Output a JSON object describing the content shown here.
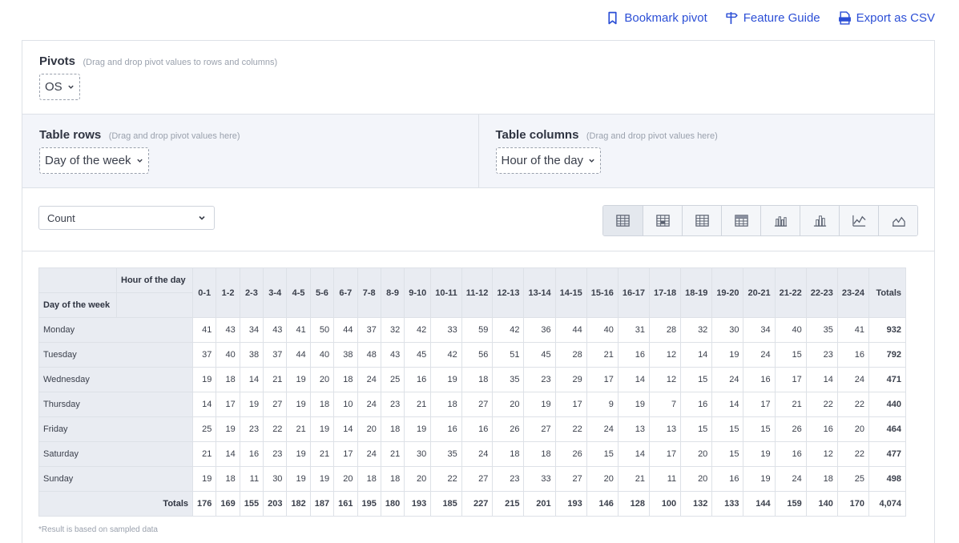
{
  "links": {
    "bookmark": "Bookmark pivot",
    "guide": "Feature Guide",
    "export": "Export as CSV"
  },
  "pivots": {
    "title": "Pivots",
    "hint": "(Drag and drop pivot values to rows and columns)",
    "chip": "OS"
  },
  "rows": {
    "title": "Table rows",
    "hint": "(Drag and drop pivot values here)",
    "chip": "Day of the week"
  },
  "columns": {
    "title": "Table columns",
    "hint": "(Drag and drop pivot values here)",
    "chip": "Hour of the day"
  },
  "metric": {
    "value": "Count"
  },
  "table": {
    "col_dim_label": "Hour of the day",
    "row_dim_label": "Day of the week",
    "hours": [
      "0-1",
      "1-2",
      "2-3",
      "3-4",
      "4-5",
      "5-6",
      "6-7",
      "7-8",
      "8-9",
      "9-10",
      "10-11",
      "11-12",
      "12-13",
      "13-14",
      "14-15",
      "15-16",
      "16-17",
      "17-18",
      "18-19",
      "19-20",
      "20-21",
      "21-22",
      "22-23",
      "23-24"
    ],
    "totals_header": "Totals",
    "rows": [
      {
        "day": "Monday",
        "values": [
          41,
          43,
          34,
          43,
          41,
          50,
          44,
          37,
          32,
          42,
          33,
          59,
          42,
          36,
          44,
          40,
          31,
          28,
          32,
          30,
          34,
          40,
          35,
          41
        ],
        "total": "932"
      },
      {
        "day": "Tuesday",
        "values": [
          37,
          40,
          38,
          37,
          44,
          40,
          38,
          48,
          43,
          45,
          42,
          56,
          51,
          45,
          28,
          21,
          16,
          12,
          14,
          19,
          24,
          15,
          23,
          16
        ],
        "total": "792"
      },
      {
        "day": "Wednesday",
        "values": [
          19,
          18,
          14,
          21,
          19,
          20,
          18,
          24,
          25,
          16,
          19,
          18,
          35,
          23,
          29,
          17,
          14,
          12,
          15,
          24,
          16,
          17,
          14,
          24
        ],
        "total": "471"
      },
      {
        "day": "Thursday",
        "values": [
          14,
          17,
          19,
          27,
          19,
          18,
          10,
          24,
          23,
          21,
          18,
          27,
          20,
          19,
          17,
          9,
          19,
          7,
          16,
          14,
          17,
          21,
          22,
          22
        ],
        "total": "440"
      },
      {
        "day": "Friday",
        "values": [
          25,
          19,
          23,
          22,
          21,
          19,
          14,
          20,
          18,
          19,
          16,
          16,
          26,
          27,
          22,
          24,
          13,
          13,
          15,
          15,
          15,
          26,
          16,
          20
        ],
        "total": "464"
      },
      {
        "day": "Saturday",
        "values": [
          21,
          14,
          16,
          23,
          19,
          21,
          17,
          24,
          21,
          30,
          35,
          24,
          18,
          18,
          26,
          15,
          14,
          17,
          20,
          15,
          19,
          16,
          12,
          22
        ],
        "total": "477"
      },
      {
        "day": "Sunday",
        "values": [
          19,
          18,
          11,
          30,
          19,
          19,
          20,
          18,
          18,
          20,
          22,
          27,
          23,
          33,
          27,
          20,
          21,
          11,
          20,
          16,
          19,
          24,
          18,
          25
        ],
        "total": "498"
      }
    ],
    "totals_label": "Totals",
    "totals": [
      176,
      169,
      155,
      203,
      182,
      187,
      161,
      195,
      180,
      193,
      185,
      227,
      215,
      201,
      193,
      146,
      128,
      100,
      132,
      133,
      144,
      159,
      140,
      170
    ],
    "grand_total": "4,074"
  },
  "footnote": "*Result is based on sampled data",
  "colors": {
    "accent": "#2c4fd6",
    "header_bg": "#e9ecf2",
    "panel_bg": "#f3f5fa"
  }
}
